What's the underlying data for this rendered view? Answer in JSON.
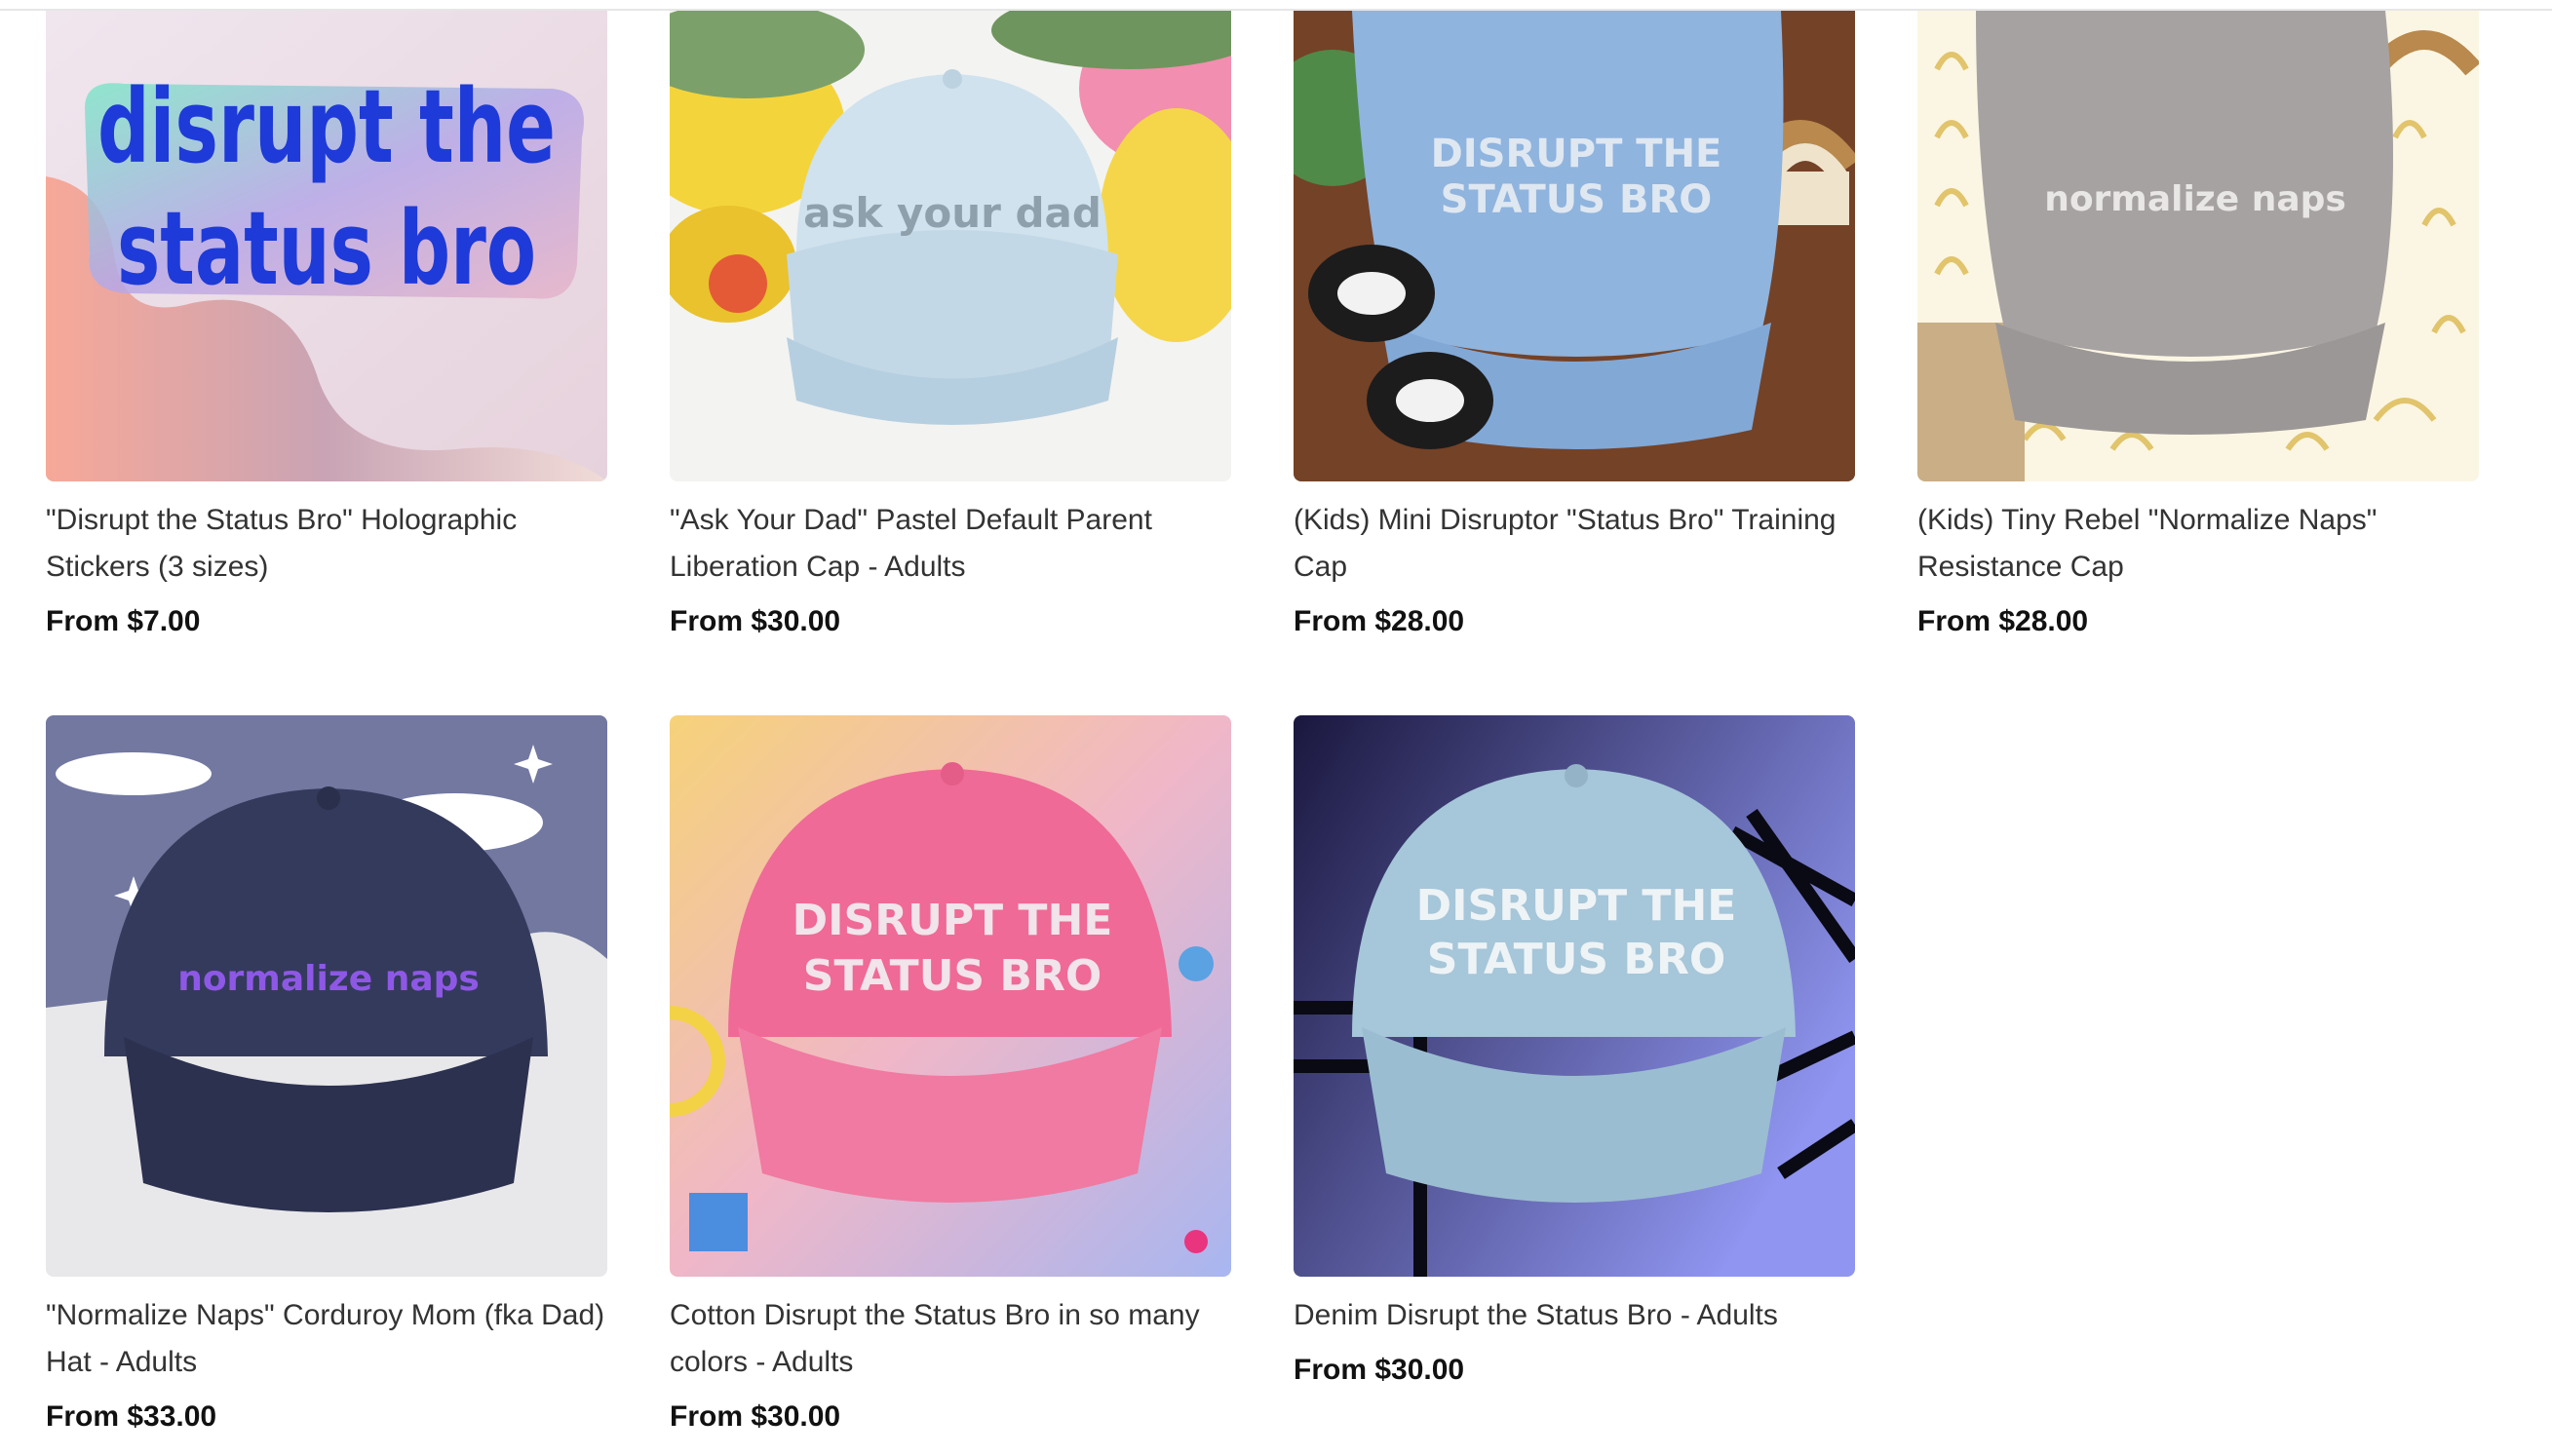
{
  "products": [
    {
      "title": "\"Disrupt the Status Bro\" Holographic Stickers (3 sizes)",
      "price": "From $7.00",
      "image_text": "disrupt the status bro",
      "image_icon": "holographic-sticker-image"
    },
    {
      "title": "\"Ask Your Dad\" Pastel Default Parent Liberation Cap - Adults",
      "price": "From $30.00",
      "image_text": "ask your dad",
      "image_icon": "pastel-cap-image"
    },
    {
      "title": "(Kids) Mini Disruptor \"Status Bro\" Training Cap",
      "price": "From $28.00",
      "image_text": "DISRUPT THE STATUS BRO",
      "image_icon": "kids-blue-cap-image"
    },
    {
      "title": "(Kids) Tiny Rebel \"Normalize Naps\" Resistance Cap",
      "price": "From $28.00",
      "image_text": "normalize naps",
      "image_icon": "kids-grey-cap-image"
    },
    {
      "title": "\"Normalize Naps\" Corduroy Mom (fka Dad) Hat - Adults",
      "price": "From $33.00",
      "image_text": "normalize naps",
      "image_icon": "corduroy-navy-cap-image"
    },
    {
      "title": "Cotton Disrupt the Status Bro in so many colors - Adults",
      "price": "From $30.00",
      "image_text": "DISRUPT THE STATUS BRO",
      "image_icon": "pink-cotton-cap-image"
    },
    {
      "title": "Denim Disrupt the Status Bro - Adults",
      "price": "From $30.00",
      "image_text": "DISRUPT THE STATUS BRO",
      "image_icon": "denim-cap-image"
    }
  ],
  "colors": {
    "title_text": "#333333",
    "price_text": "#111111",
    "divider": "#e6e6e6"
  }
}
